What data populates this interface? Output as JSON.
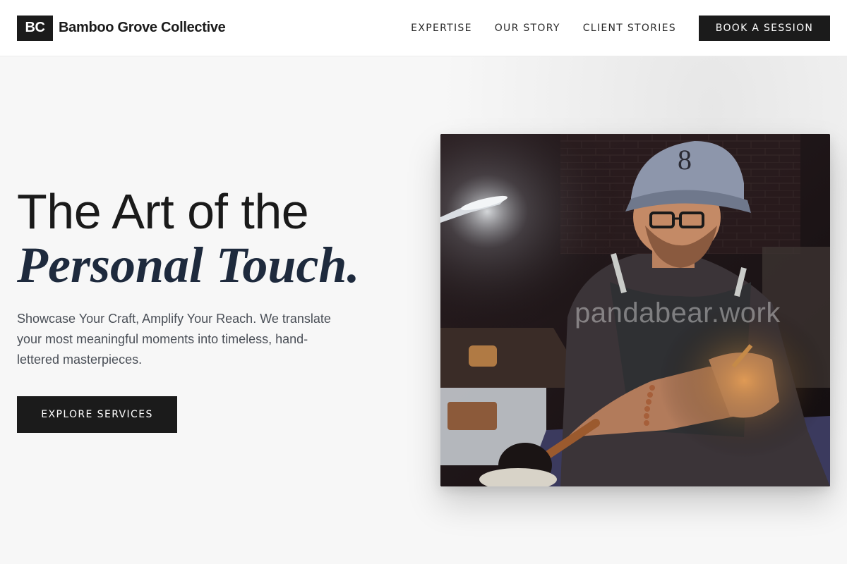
{
  "brand": {
    "mark": "BC",
    "name": "Bamboo Grove Collective"
  },
  "nav": {
    "items": [
      {
        "label": "EXPERTISE"
      },
      {
        "label": "OUR STORY"
      },
      {
        "label": "CLIENT STORIES"
      }
    ],
    "cta_label": "BOOK A SESSION"
  },
  "hero": {
    "headline_line1": "The Art of the",
    "headline_line2": "Personal Touch.",
    "subtext": "Showcase Your Craft, Amplify Your Reach. We translate your most meaningful moments into timeless, hand-lettered masterpieces.",
    "button_label": "EXPLORE SERVICES"
  },
  "image": {
    "watermark": "pandabear.work"
  }
}
